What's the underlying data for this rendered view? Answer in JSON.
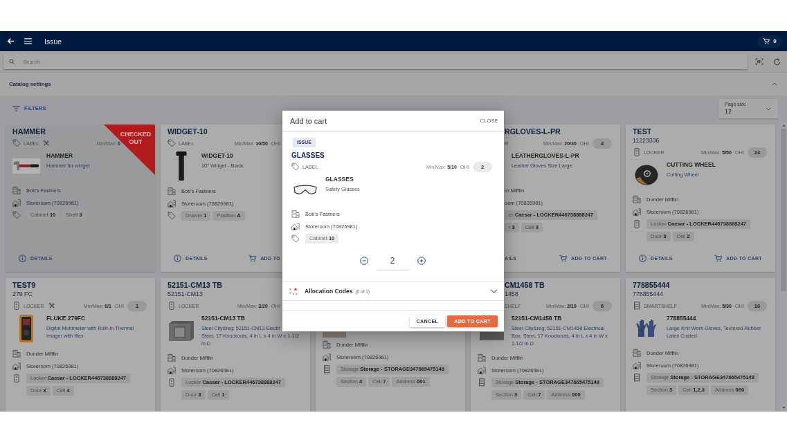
{
  "header": {
    "title": "Issue",
    "cart_count": "0"
  },
  "search": {
    "placeholder": "Search"
  },
  "catalog_settings": {
    "title": "Catalog settings",
    "expanded": true
  },
  "filters": {
    "label": "FILTERS",
    "page_size": {
      "label": "Page size",
      "value": "12"
    }
  },
  "cards": [
    {
      "title": "HAMMER",
      "checked_out": true,
      "ribbon": "CHECKED OUT",
      "type": {
        "kind": "label",
        "text": "LABEL"
      },
      "tool": true,
      "min_max": "Min/Max: **0**",
      "item": {
        "kind": "hammer",
        "name": "HAMMER",
        "description": "Hammer for widget"
      },
      "locations": [
        {
          "kind": "site",
          "text": "Bob's Fastners"
        },
        {
          "kind": "storeroom",
          "text": "Storeroom (70826981)"
        },
        {
          "kind": "bin",
          "chips": [
            "Cabinet **10**",
            "Shelf **3**"
          ]
        }
      ],
      "actions": [
        {
          "kind": "details",
          "label": "DETAILS"
        }
      ]
    },
    {
      "title": "WIDGET-10",
      "checked_out": false,
      "type": {
        "kind": "label",
        "text": "LABEL"
      },
      "tool": false,
      "min_max": "Min/Max: **10/50**",
      "ohi_label": "OHI",
      "item": {
        "kind": "bolt",
        "name": "WIDGET-10",
        "description": "10\" Widget - Black"
      },
      "locations": [
        {
          "kind": "site",
          "text": "Bob's Fastners"
        },
        {
          "kind": "storeroom",
          "text": "Storeroom (70826981)"
        },
        {
          "kind": "bin",
          "chips": [
            "Drawer **1**",
            "Position **A**"
          ]
        }
      ],
      "actions": [
        {
          "kind": "details",
          "label": "DETAILS"
        },
        {
          "kind": "cart",
          "label": "ADD TO"
        }
      ]
    },
    {
      "title": "RGLOVES-L-PR",
      "checked_out": false,
      "type": {
        "text": "R"
      },
      "tool": false,
      "min_max": "Min/Max: **20/30**",
      "ohi_label": "OHI",
      "ohi": "4",
      "item": {
        "name": "LEATHERGLOVES-L-PR",
        "description": "Leather Gloves Size Large"
      },
      "locations": [
        {
          "text": "er Mifflin"
        },
        {
          "text": "oom (70826981)"
        },
        {
          "chips": [
            "er **Caesar - LOCKER446738888247**"
          ]
        },
        {
          "chips": [
            "r **3**",
            "Cell **3**"
          ]
        }
      ],
      "actions": [
        {
          "label": "AILS"
        },
        {
          "kind": "cart",
          "label": "ADD TO CART"
        }
      ]
    },
    {
      "title": "TEST",
      "subtitle": "11223336",
      "checked_out": false,
      "type": {
        "kind": "locker",
        "text": "LOCKER"
      },
      "tool": false,
      "min_max": "Min/Max: **5/50**",
      "ohi_label": "OHI",
      "ohi": "24",
      "item": {
        "kind": "wheel",
        "name": "CUTTING WHEEL",
        "description": "Cutting Wheel"
      },
      "locations": [
        {
          "kind": "site",
          "text": "Dunder Mifflin"
        },
        {
          "kind": "storeroom",
          "text": "Storeroom (70826981)"
        },
        {
          "kind": "locker",
          "chips": [
            "Locker **Caesar - LOCKER446738888247**"
          ]
        },
        {
          "chips": [
            "Door **3**",
            "Cell **2**"
          ]
        }
      ],
      "actions": [
        {
          "kind": "details",
          "label": "DETAILS"
        },
        {
          "kind": "cart",
          "label": "ADD TO CART"
        }
      ]
    },
    {
      "title": "TEST9",
      "subtitle": "279 FC",
      "checked_out": false,
      "type": {
        "kind": "locker",
        "text": "LOCKER"
      },
      "tool": true,
      "min_max": "Min/Max: **0/1**",
      "ohi_label": "OHI",
      "ohi": "1",
      "item": {
        "kind": "multimeter",
        "name": "FLUKE 279FC",
        "description": "Digital Multimeter with Built-In Thermal Imager with Iflex"
      },
      "locations": [
        {
          "kind": "site",
          "text": "Dunder Mifflin"
        },
        {
          "kind": "storeroom",
          "text": "Storeroom (70826981)"
        },
        {
          "kind": "locker",
          "chips": [
            "Locker **Caesar - LOCKER446738888247**"
          ]
        },
        {
          "chips": [
            "Door **3**",
            "Cell **4**"
          ]
        }
      ]
    },
    {
      "title": "52151-CM13 TB",
      "subtitle": "52151-CM13",
      "checked_out": false,
      "type": {
        "kind": "locker",
        "text": "LOCKER"
      },
      "tool": false,
      "min_max": "Min/Max: **3/20**",
      "ohi_label": "OHI",
      "item": {
        "kind": "box",
        "name": "52151-CM13 TB",
        "description": [
          "Steel City&reg; 52151-CM13 Electri",
          "Steel, 17 Knockouts, 4 in L x 4 in W x 1-1/2 in D"
        ]
      },
      "locations": [
        {
          "kind": "site",
          "text": "Dunder Mifflin"
        },
        {
          "kind": "storeroom",
          "text": "Storeroom (70826981)"
        },
        {
          "kind": "locker",
          "chips": [
            "Locker **Caesar - LOCKER446738888247**"
          ]
        },
        {
          "chips": [
            "Door **3**",
            "Cell **1**"
          ]
        }
      ]
    },
    {
      "locations": [
        {
          "kind": "site",
          "text": "Dunder Mifflin"
        },
        {
          "kind": "storeroom",
          "text": "Storeroom (70826981)"
        },
        {
          "kind": "storage",
          "chips": [
            "Storage **Storage - STORAGE347665475148**"
          ]
        },
        {
          "chips": [
            "Section **4**",
            "Cell **7**",
            "Address **001**"
          ]
        }
      ]
    },
    {
      "title": "CM1458 TB",
      "subtitle": "1458",
      "checked_out": false,
      "type": {
        "text": "SHELF"
      },
      "tool": false,
      "min_max": "Min/Max: **2/10**",
      "ohi_label": "OHI",
      "ohi": "6",
      "item": {
        "name": "52151-CM1458 TB",
        "description": "Steel City&reg; 52151-CM1458 Electrical Box, Steel, 17 Knockouts, 4 in L x 4 in W x 1-1/2 in D"
      },
      "locations": [
        {
          "kind": "site",
          "text": "Dunder Mifflin"
        },
        {
          "kind": "storeroom",
          "text": "Storeroom (70826981)"
        },
        {
          "kind": "storage",
          "chips": [
            "Storage **Storage - STORAGE347665475148**"
          ]
        },
        {
          "chips": [
            "Section **3**",
            "Cell **7**",
            "Address **000**"
          ]
        }
      ]
    },
    {
      "title": "778855444",
      "subtitle": "778855444",
      "checked_out": false,
      "type": {
        "kind": "smartshelf",
        "text": "SMARTSHELF"
      },
      "tool": false,
      "min_max": "Min/Max: **5/30**",
      "ohi_label": "OHI",
      "ohi": "10",
      "item": {
        "kind": "gloves",
        "name": "778855444",
        "description": "Large Knit Work Gloves, Textured Rubber Latex Coated"
      },
      "locations": [
        {
          "kind": "site",
          "text": "Dunder Mifflin"
        },
        {
          "kind": "storeroom",
          "text": "Storeroom (70826981)"
        },
        {
          "kind": "storage",
          "chips": [
            "Storage **Storage - STORAGE347665475148**"
          ]
        },
        {
          "chips": [
            "Section **3**",
            "Cell **1,2,3**",
            "Address **000**"
          ]
        }
      ]
    }
  ],
  "modal": {
    "title": "Add to cart",
    "close": "CLOSE",
    "badge": "ISSUE",
    "heading": "GLASSES",
    "type": {
      "kind": "label",
      "text": "LABEL"
    },
    "min_max": "Min/Max: **5/10**",
    "ohi_label": "OHI",
    "ohi": "2",
    "item": {
      "kind": "glasses",
      "name": "GLASSES",
      "description": "Safety Glasses"
    },
    "locations": [
      {
        "kind": "site",
        "text": "Bob's Fastners"
      },
      {
        "kind": "storeroom",
        "text": "Storeroom (70826981)"
      },
      {
        "kind": "bin",
        "chips": [
          "Cabinet **10**"
        ]
      }
    ],
    "quantity": "2",
    "allocation": {
      "label": "Allocation Codes",
      "count": "(0 of 1)",
      "expanded": false,
      "warning": true
    },
    "buttons": [
      {
        "kind": "secondary",
        "label": "CANCEL"
      },
      {
        "kind": "primary",
        "label": "ADD TO CART"
      }
    ]
  }
}
